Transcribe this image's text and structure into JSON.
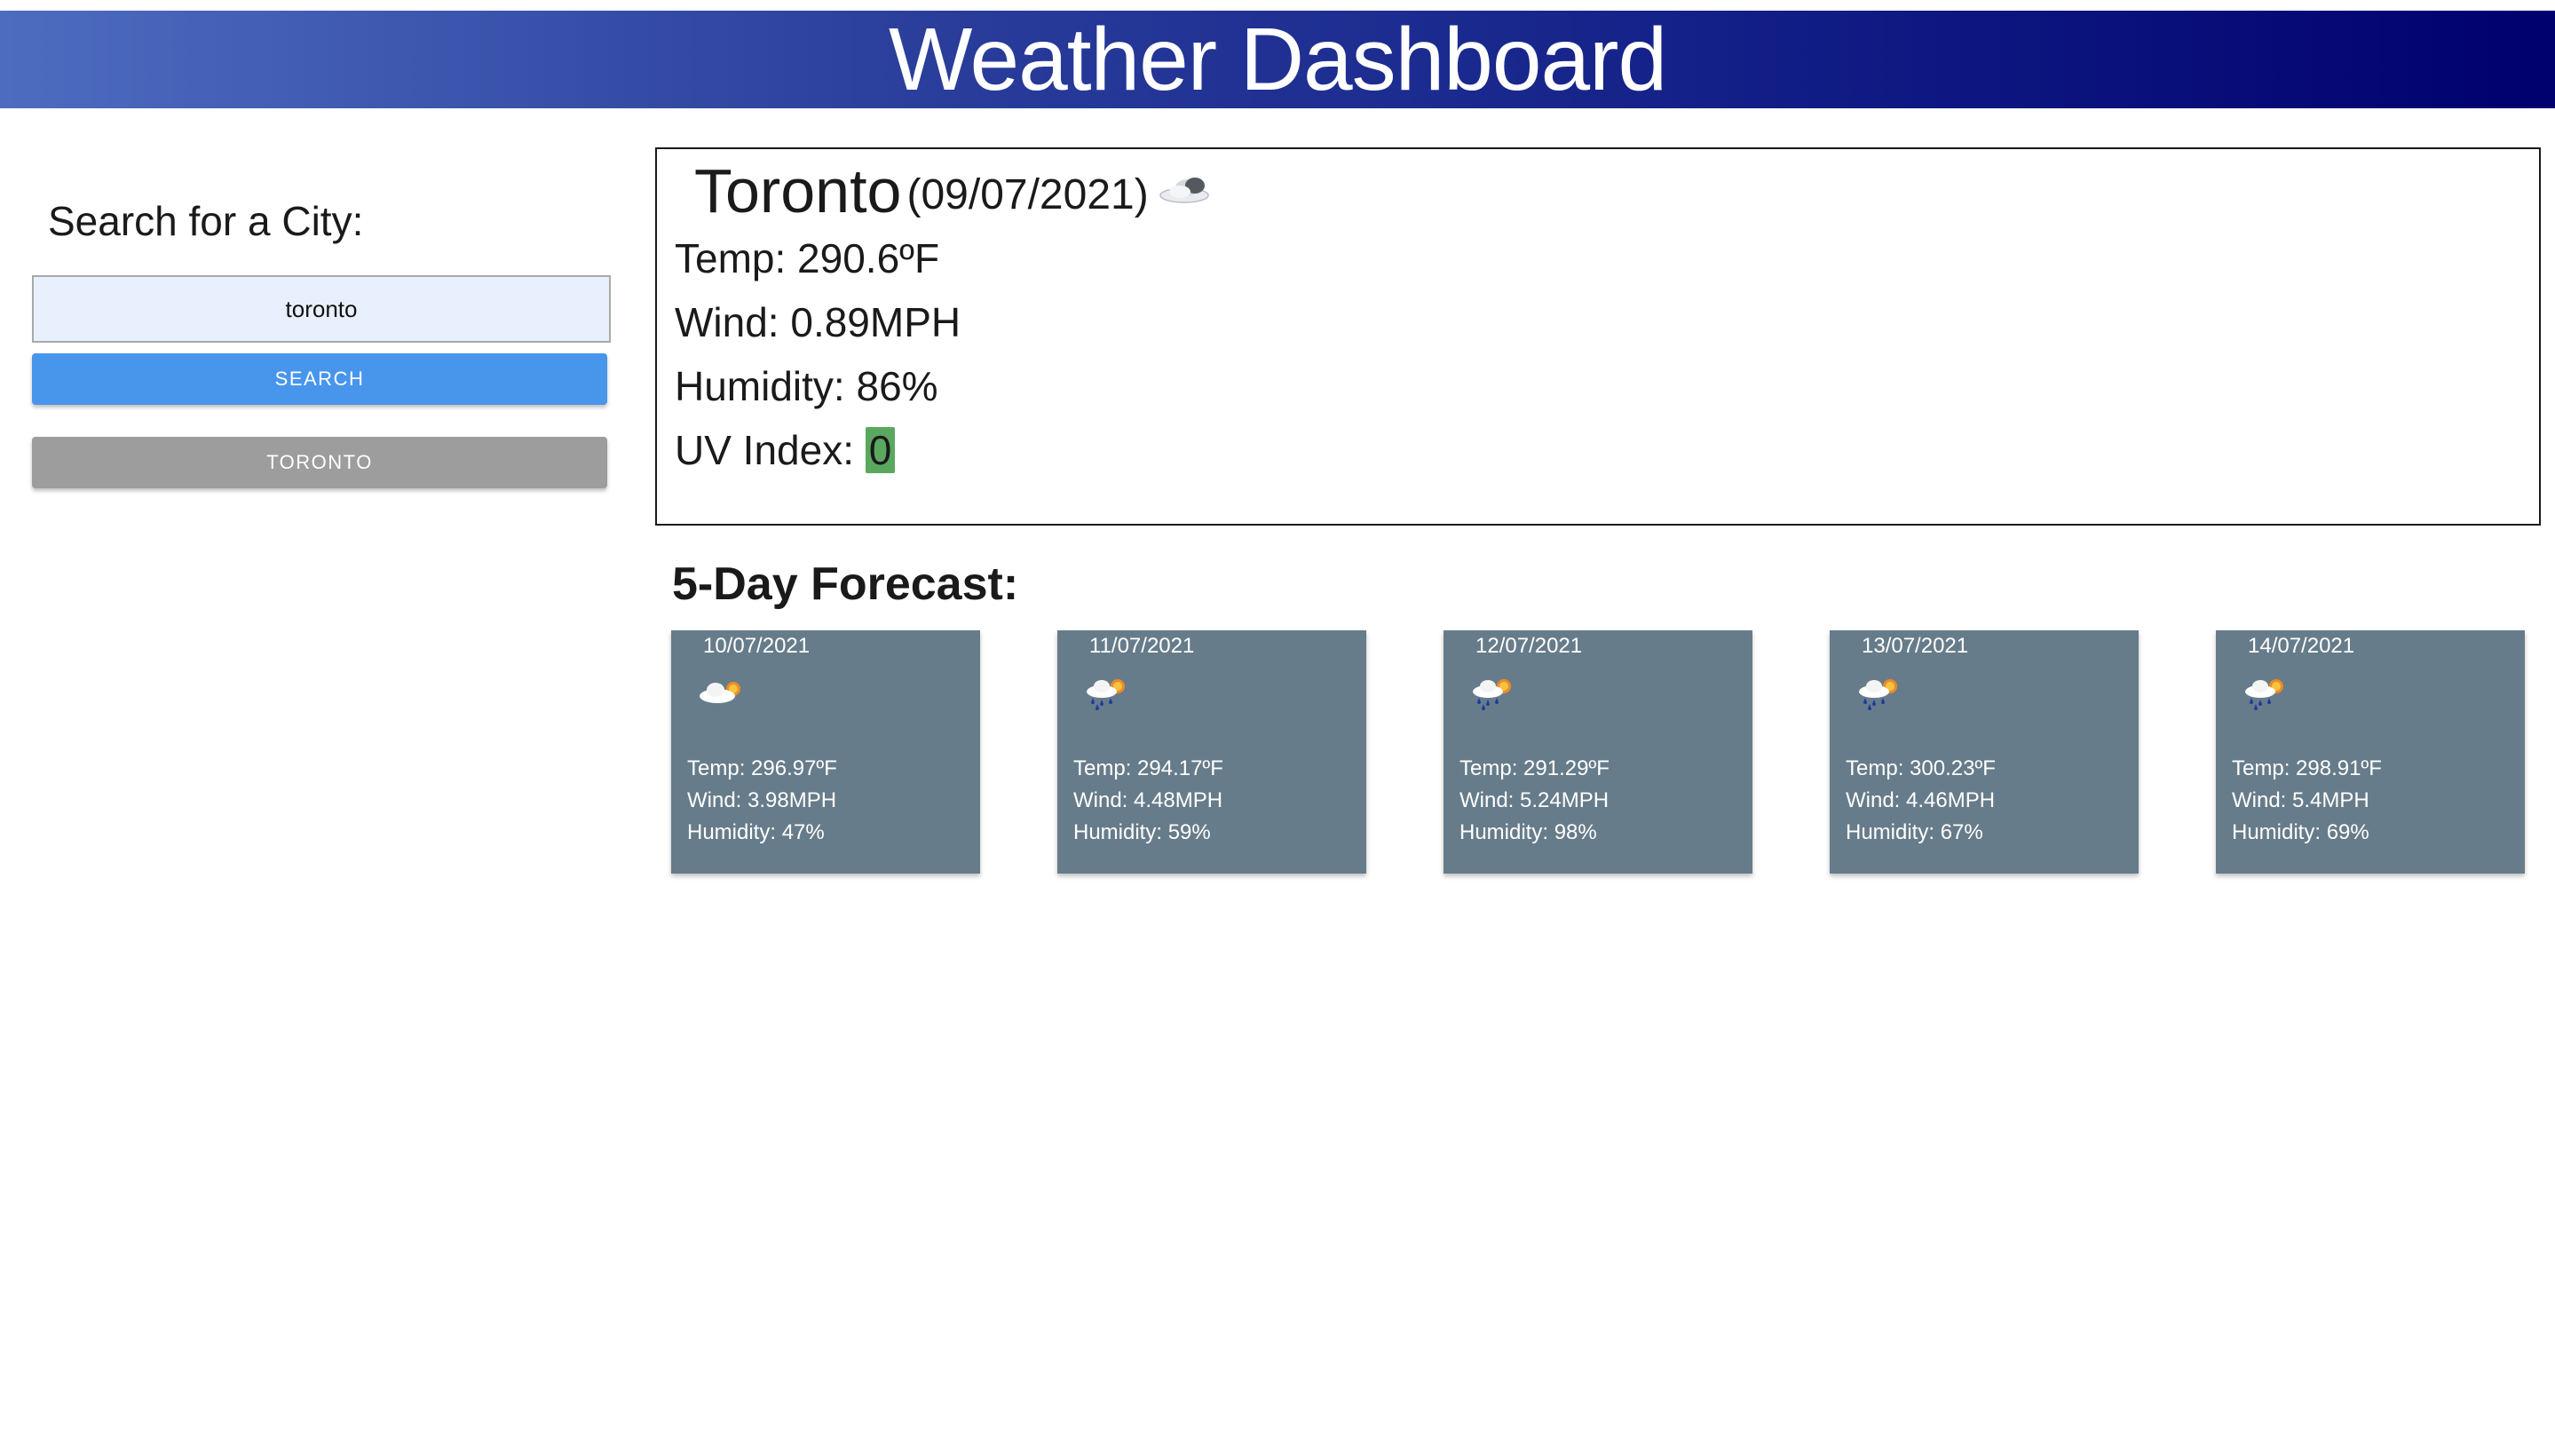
{
  "header": {
    "title": "Weather Dashboard"
  },
  "search": {
    "heading": "Search for a City:",
    "input_value": "toronto",
    "button_label": "SEARCH",
    "history": [
      "TORONTO"
    ]
  },
  "current": {
    "city": "Toronto",
    "date": "(09/07/2021)",
    "icon": "cloud-icon",
    "temp_label": "Temp: 290.6ºF",
    "wind_label": "Wind: 0.89MPH",
    "humidity_label": "Humidity: 86%",
    "uv_label": "UV Index: ",
    "uv_value": "0",
    "uv_color": "#5aa85f"
  },
  "forecast": {
    "heading": "5-Day Forecast:",
    "card_color": "#677c8a",
    "days": [
      {
        "date": "10/07/2021",
        "icon": "partly-cloudy-icon",
        "temp": "Temp: 296.97ºF",
        "wind": "Wind: 3.98MPH",
        "humidity": "Humidity: 47%"
      },
      {
        "date": "11/07/2021",
        "icon": "sun-rain-icon",
        "temp": "Temp: 294.17ºF",
        "wind": "Wind: 4.48MPH",
        "humidity": "Humidity: 59%"
      },
      {
        "date": "12/07/2021",
        "icon": "sun-rain-icon",
        "temp": "Temp: 291.29ºF",
        "wind": "Wind: 5.24MPH",
        "humidity": "Humidity: 98%"
      },
      {
        "date": "13/07/2021",
        "icon": "sun-rain-icon",
        "temp": "Temp: 300.23ºF",
        "wind": "Wind: 4.46MPH",
        "humidity": "Humidity: 67%"
      },
      {
        "date": "14/07/2021",
        "icon": "sun-rain-icon",
        "temp": "Temp: 298.91ºF",
        "wind": "Wind: 5.4MPH",
        "humidity": "Humidity: 69%"
      }
    ]
  }
}
